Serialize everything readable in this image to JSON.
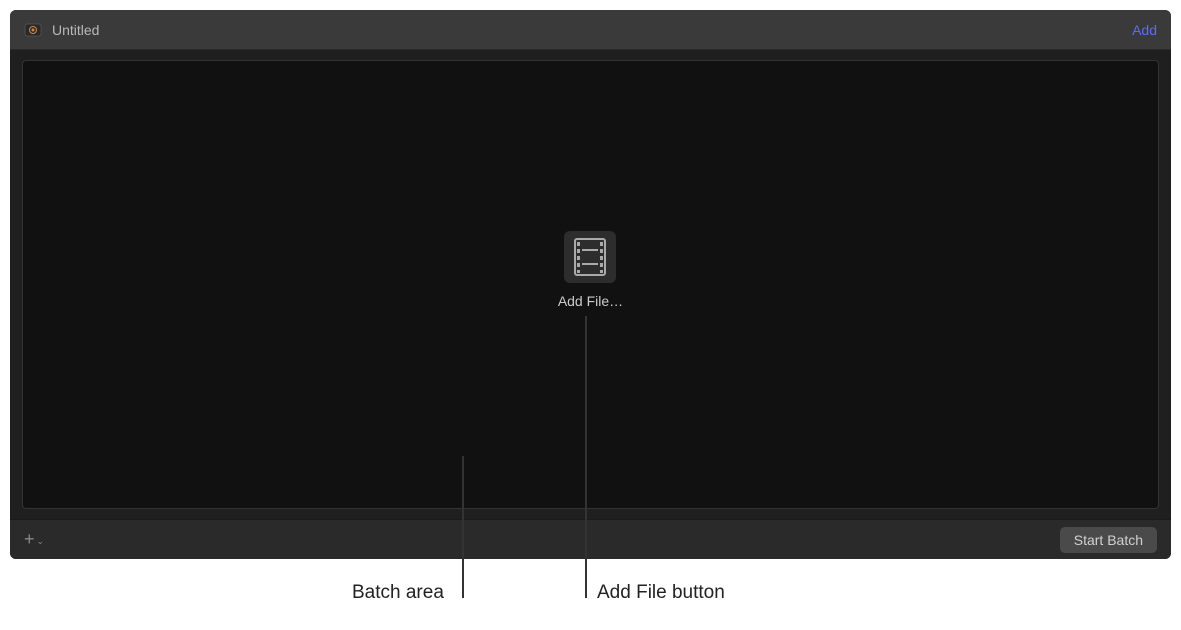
{
  "header": {
    "title": "Untitled",
    "add_link": "Add"
  },
  "batch": {
    "add_file_label": "Add File…"
  },
  "footer": {
    "start_batch_label": "Start Batch"
  },
  "callouts": {
    "batch_area": "Batch area",
    "add_file_button": "Add File button"
  }
}
